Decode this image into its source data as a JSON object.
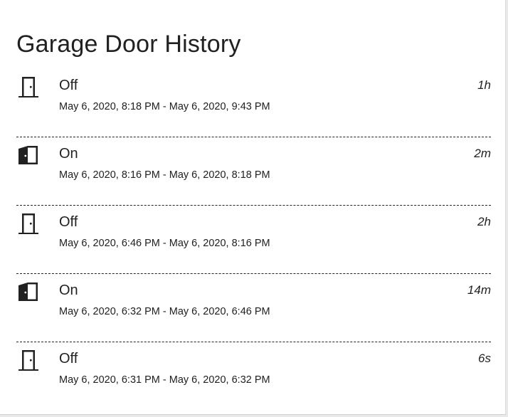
{
  "card": {
    "title": "Garage Door History"
  },
  "entries": [
    {
      "state": "Off",
      "range": "May 6, 2020, 8:18 PM - May 6, 2020, 9:43 PM",
      "duration": "1h",
      "icon": "door-closed-icon"
    },
    {
      "state": "On",
      "range": "May 6, 2020, 8:16 PM - May 6, 2020, 8:18 PM",
      "duration": "2m",
      "icon": "door-open-icon"
    },
    {
      "state": "Off",
      "range": "May 6, 2020, 6:46 PM - May 6, 2020, 8:16 PM",
      "duration": "2h",
      "icon": "door-closed-icon"
    },
    {
      "state": "On",
      "range": "May 6, 2020, 6:32 PM - May 6, 2020, 6:46 PM",
      "duration": "14m",
      "icon": "door-open-icon"
    },
    {
      "state": "Off",
      "range": "May 6, 2020, 6:31 PM - May 6, 2020, 6:32 PM",
      "duration": "6s",
      "icon": "door-closed-icon"
    }
  ],
  "colors": {
    "text": "#212121",
    "card_background": "#ffffff",
    "page_background": "#e9e9e9",
    "divider": "#222222"
  }
}
